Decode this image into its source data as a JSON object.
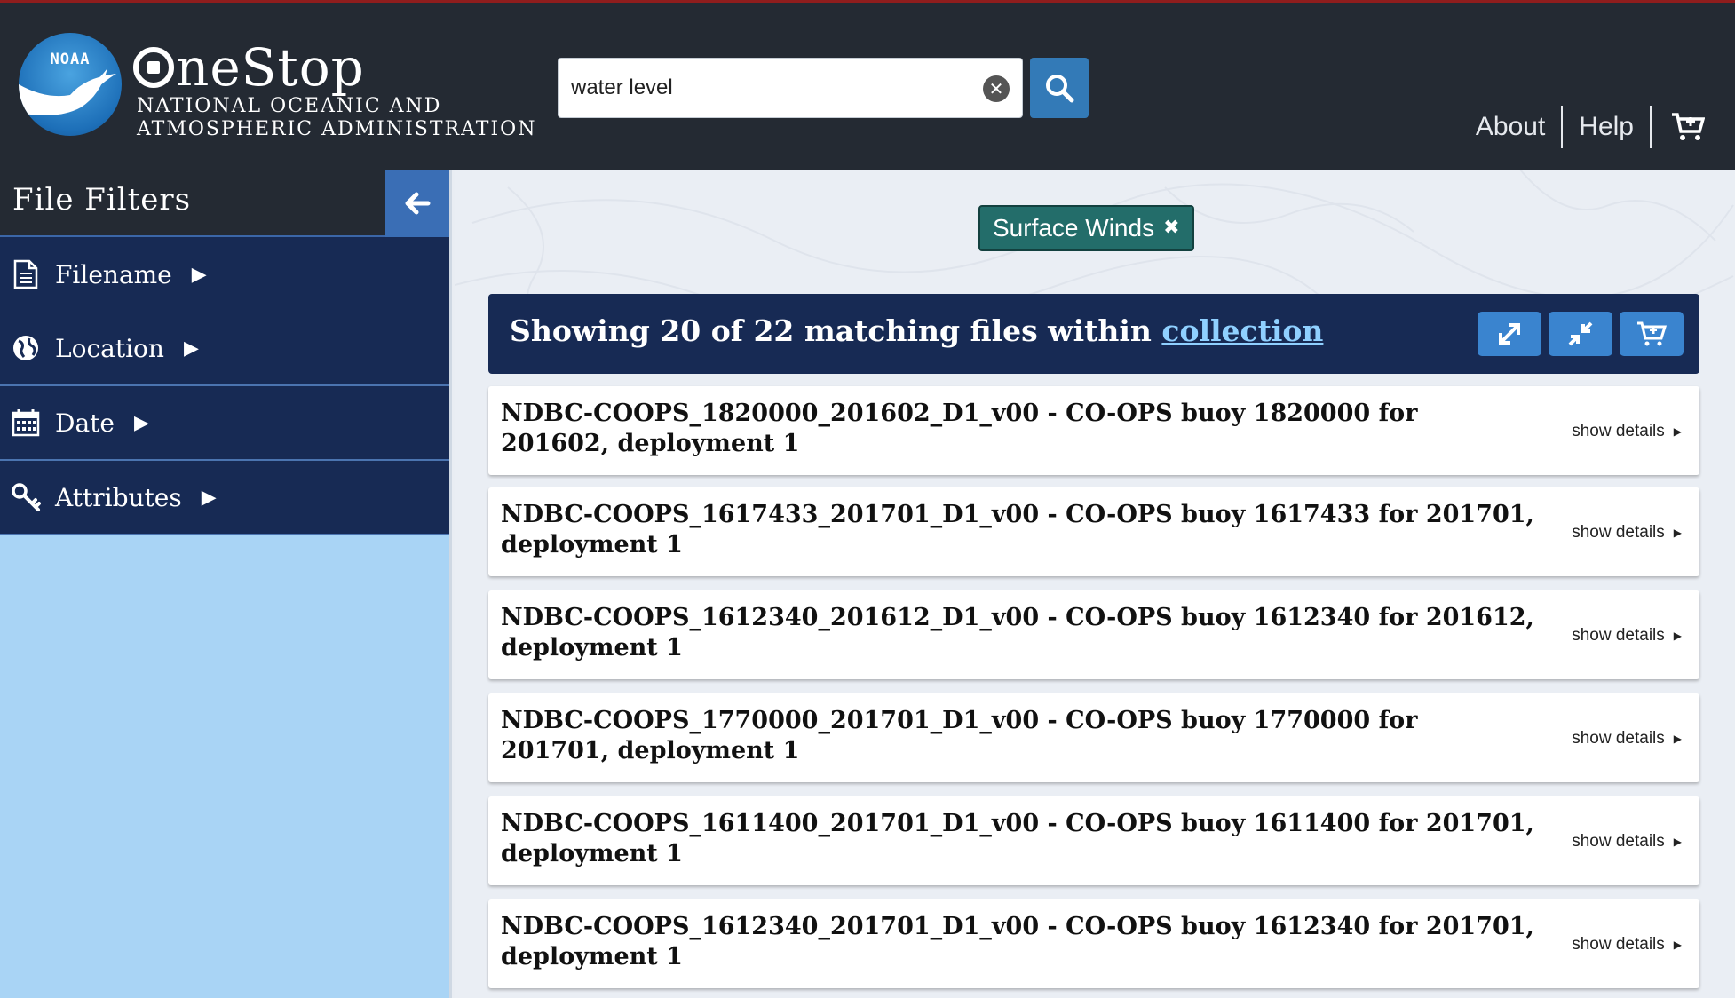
{
  "header": {
    "logo_text": "NOAA",
    "brand_title": "neStop",
    "brand_sub_line1": "NATIONAL OCEANIC AND",
    "brand_sub_line2": "ATMOSPHERIC ADMINISTRATION",
    "search": {
      "value": "water level",
      "clear_icon": "close-circle-icon",
      "search_icon": "magnifier-icon"
    },
    "nav": {
      "about": "About",
      "help": "Help",
      "cart_icon": "cart-icon"
    },
    "colors": {
      "bg": "#242a33",
      "accent": "#337ab7"
    }
  },
  "sidebar": {
    "title": "File Filters",
    "collapse_icon": "arrow-left-icon",
    "items": [
      {
        "label": "Filename",
        "icon": "document-icon",
        "arrow": "▶"
      },
      {
        "label": "Location",
        "icon": "globe-icon",
        "arrow": "▶"
      },
      {
        "label": "Date",
        "icon": "calendar-icon",
        "arrow": "▶"
      },
      {
        "label": "Attributes",
        "icon": "key-search-icon",
        "arrow": "▶"
      }
    ]
  },
  "main": {
    "tag": {
      "label": "Surface Winds",
      "remove": "✖"
    },
    "results": {
      "prefix": "Showing 20 of 22 matching files within ",
      "link": "collection",
      "buttons": [
        "expand-icon",
        "collapse-icon",
        "add-to-cart-icon"
      ]
    },
    "files": [
      {
        "title": "NDBC-COOPS_1820000_201602_D1_v00 - CO-OPS buoy 1820000 for 201602, deployment 1",
        "details": "show details"
      },
      {
        "title": "NDBC-COOPS_1617433_201701_D1_v00 - CO-OPS buoy 1617433 for 201701, deployment 1",
        "details": "show details"
      },
      {
        "title": "NDBC-COOPS_1612340_201612_D1_v00 - CO-OPS buoy 1612340 for 201612, deployment 1",
        "details": "show details"
      },
      {
        "title": "NDBC-COOPS_1770000_201701_D1_v00 - CO-OPS buoy 1770000 for 201701, deployment 1",
        "details": "show details"
      },
      {
        "title": "NDBC-COOPS_1611400_201701_D1_v00 - CO-OPS buoy 1611400 for 201701, deployment 1",
        "details": "show details"
      },
      {
        "title": "NDBC-COOPS_1612340_201701_D1_v00 - CO-OPS buoy 1612340 for 201701, deployment 1",
        "details": "show details"
      }
    ]
  }
}
